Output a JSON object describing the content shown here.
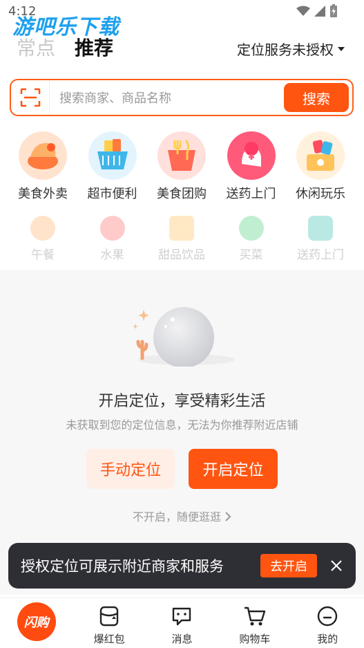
{
  "status_bar": {
    "time": "4:12"
  },
  "watermark": {
    "text": "游吧乐下载"
  },
  "header": {
    "tabs": [
      {
        "label": "常点"
      },
      {
        "label": "推荐"
      }
    ],
    "location_status": "定位服务未授权"
  },
  "search": {
    "placeholder": "搜索商家、商品名称",
    "button_label": "搜索"
  },
  "categories": [
    {
      "label": "美食外卖",
      "icon": "food-delivery-icon",
      "color": "#ff7a3d"
    },
    {
      "label": "超市便利",
      "icon": "basket-icon",
      "color": "#3fb6ea"
    },
    {
      "label": "美食团购",
      "icon": "fork-knife-icon",
      "color": "#ff6a55"
    },
    {
      "label": "送药上门",
      "icon": "medicine-icon",
      "color": "#ff5a7a"
    },
    {
      "label": "休闲玩乐",
      "icon": "leisure-icon",
      "color": "#ff9a3a"
    }
  ],
  "subcategories": [
    {
      "label": "午餐",
      "color": "#ffb26b"
    },
    {
      "label": "水果",
      "color": "#ff6b6b"
    },
    {
      "label": "甜品饮品",
      "color": "#ffc35a"
    },
    {
      "label": "买菜",
      "color": "#4ccf7a"
    },
    {
      "label": "送药上门",
      "color": "#3bc2b0"
    }
  ],
  "empty_state": {
    "title": "开启定位，享受精彩生活",
    "subtitle": "未获取到您的定位信息，无法为你推荐附近店铺",
    "manual_button": "手动定位",
    "enable_button": "开启定位",
    "skip_link": "不开启，随便逛逛"
  },
  "toast": {
    "text": "授权定位可展示附近商家和服务",
    "action": "去开启"
  },
  "bottom_nav": [
    {
      "label": "闪购",
      "icon": "shangou-home-icon"
    },
    {
      "label": "爆红包",
      "icon": "red-packet-icon"
    },
    {
      "label": "消息",
      "icon": "message-icon"
    },
    {
      "label": "购物车",
      "icon": "cart-icon"
    },
    {
      "label": "我的",
      "icon": "profile-icon"
    }
  ],
  "colors": {
    "accent": "#ff5511",
    "toast_bg": "#2e2e35"
  }
}
